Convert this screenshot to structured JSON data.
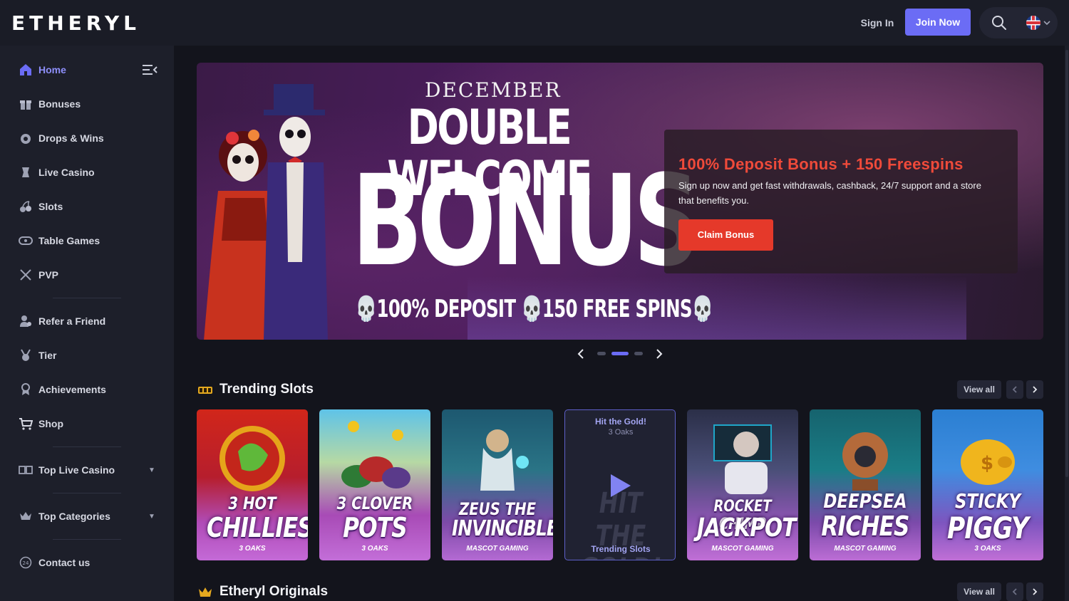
{
  "header": {
    "logo": "ETHERYL",
    "sign_in": "Sign In",
    "join_now": "Join Now",
    "search_icon": "search-icon",
    "language_icon": "uk-flag-icon"
  },
  "sidebar": {
    "items": [
      {
        "label": "Home",
        "icon": "home-icon",
        "active": true
      },
      {
        "label": "Bonuses",
        "icon": "gift-icon"
      },
      {
        "label": "Drops & Wins",
        "icon": "drops-icon"
      },
      {
        "label": "Live Casino",
        "icon": "live-casino-icon"
      },
      {
        "label": "Slots",
        "icon": "cherries-icon"
      },
      {
        "label": "Table Games",
        "icon": "table-games-icon"
      },
      {
        "label": "PVP",
        "icon": "swords-icon"
      },
      {
        "label": "Refer a Friend",
        "icon": "refer-icon"
      },
      {
        "label": "Tier",
        "icon": "medal-icon"
      },
      {
        "label": "Achievements",
        "icon": "achievement-icon"
      },
      {
        "label": "Shop",
        "icon": "cart-icon"
      },
      {
        "label": "Top Live Casino",
        "icon": "cards-icon"
      },
      {
        "label": "Top Categories",
        "icon": "crown-icon"
      },
      {
        "label": "Contact us",
        "icon": "support-24-icon"
      }
    ]
  },
  "banner": {
    "month": "DECEMBER",
    "title_line1": "DOUBLE WELCOME",
    "title_line2": "BONUS",
    "subtitle": "💀100% DEPOSIT 💀150 FREE SPINS💀",
    "promo_title": "100% Deposit Bonus + 150 Freespins",
    "promo_desc": "Sign up now and get fast withdrawals, cashback, 24/7 support and a store that benefits you.",
    "cta": "Claim Bonus",
    "slides": 3,
    "active_slide": 2
  },
  "trending": {
    "title": "Trending Slots",
    "view_all": "View all",
    "cards": [
      {
        "name1": "3 HOT",
        "name2": "CHILLIES",
        "provider": "3 OAKS"
      },
      {
        "name1": "3 CLOVER",
        "name2": "POTS",
        "provider": "3 OAKS"
      },
      {
        "name1": "ZEUS THE",
        "name2": "INVINCIBLE",
        "provider": "MASCOT GAMING"
      },
      {
        "hover_title": "Hit the Gold!",
        "hover_provider": "3 Oaks",
        "ghost": "HIT THE GOLD!",
        "tag": "Trending Slots"
      },
      {
        "name1": "ROCKET CHIMP",
        "name2": "JACKPOT",
        "provider": "MASCOT GAMING"
      },
      {
        "name1": "DEEPSEA",
        "name2": "RICHES",
        "provider": "MASCOT GAMING"
      },
      {
        "name1": "STICKY",
        "name2": "PIGGY",
        "provider": "3 OAKS"
      }
    ]
  },
  "originals": {
    "title": "Etheryl Originals",
    "view_all": "View all"
  },
  "colors": {
    "accent": "#6b6cf5",
    "cta_red": "#e5392a",
    "promo_red": "#ef4a3a",
    "sidebar_bg": "#1d1f2a",
    "main_bg": "#13141c"
  }
}
